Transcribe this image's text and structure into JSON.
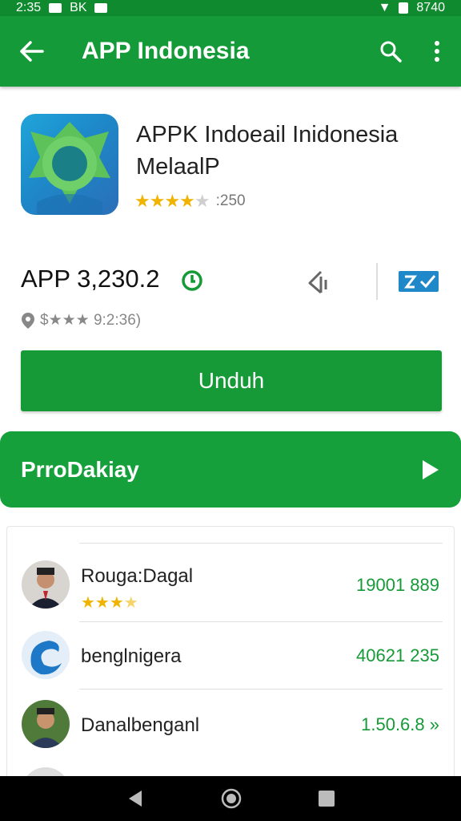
{
  "status_bar": {
    "time": "2:35",
    "left_text": "BK",
    "right_text": "8740"
  },
  "app_bar": {
    "title": "APP Indonesia"
  },
  "app": {
    "name": "APPK Indoeail Inidonesia MelaalP",
    "rating_count": ":250",
    "stars_filled": 4,
    "price": "APP 3,230.2",
    "meta": "$★★★ 9:2:36)"
  },
  "install_button": {
    "label": "Unduh"
  },
  "promo": {
    "label": "PrroDakiay"
  },
  "list": [
    {
      "name": "Rouga:Dagal",
      "value": "19001 889",
      "stars_filled": 4
    },
    {
      "name": "benglnigera",
      "value": "40621 235"
    },
    {
      "name": "Danalbenganl",
      "value": "1.50.6.8 »"
    }
  ],
  "colors": {
    "primary": "#159a3a",
    "accent_star": "#f0b400",
    "value_green": "#169a38"
  }
}
